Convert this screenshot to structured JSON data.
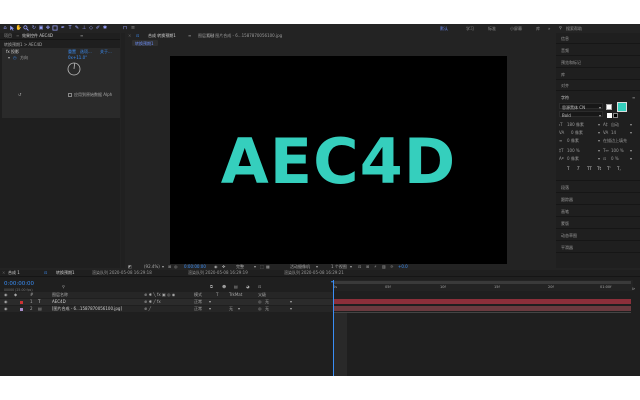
{
  "colors": {
    "accent": "#3a8ef6",
    "text_color": "#35cfbd",
    "layer_bar_1": "#8c2f3a",
    "layer_bar_2": "#6b3a3f",
    "swatch": "#35cfbd"
  },
  "toolbar": {
    "workspaces": [
      "默认",
      "学习",
      "标准",
      "小屏幕",
      "库"
    ],
    "search_placeholder": "搜索帮助"
  },
  "project": {
    "tabs": [
      "项目",
      "效果控件 AEC4D"
    ],
    "breadcrumb": "转换预期1 > AEC4D",
    "effect_name": "fx  投影",
    "reset_label": "重置",
    "options_label": "选项...",
    "about_label": "关于...",
    "prop_name": "方向",
    "prop_value": "0x+11.0°",
    "checkbox_label": "应用到原始数据 Alph"
  },
  "composition": {
    "tabs": [
      "合成 转换预期1",
      "图层 (无)",
      "素材 图片合成 - 6...1587870056100.jpg"
    ],
    "subtab": "转换预期1",
    "comp_text": "AEC4D",
    "zoom": "(92.4%)",
    "timecode": "0:00:00:00",
    "quality": "完整",
    "camera": "活动摄像机",
    "views": "1 个视图",
    "exposure": "+0.0"
  },
  "right_panel": {
    "items_top": [
      "信息",
      "音频",
      "预览和标记",
      "库",
      "对齐"
    ],
    "char_title": "字符",
    "font_family": "思源黑体 CN",
    "font_style": "Bold",
    "font_size": "180 像素",
    "leading": "自动",
    "kerning": "0 像素",
    "tracking": "14",
    "stroke": "在描边上填充",
    "vscale": "100 %",
    "hscale": "100 %",
    "baseline": "0 像素",
    "tsume": "0 %",
    "format_buttons": [
      "T",
      "T",
      "TT",
      "Tt",
      "T'",
      "T,"
    ],
    "items_bottom": [
      "段落",
      "跟踪器",
      "画笔",
      "蒙版",
      "动态草图",
      "平滑器"
    ]
  },
  "timeline": {
    "tabs": [
      "合成 1",
      "转换预期1",
      "渲染队列 2020-05-08 16:29:18",
      "渲染队列 2020-05-08 16:29:19",
      "渲染队列 2020-05-08 16:29:21"
    ],
    "timecode": "0:00:00:00",
    "frame_info": "00000 (25.00 fps)",
    "headers": [
      "图层名称",
      "模式",
      "T",
      "TrkMat",
      "父级"
    ],
    "layers": [
      {
        "num": "1",
        "name": "AEC4D",
        "mode": "正常",
        "trkmat": "",
        "parent": "无",
        "type": "text"
      },
      {
        "num": "2",
        "name": "[图片合成 - 6...1587870056100.jpg]",
        "mode": "正常",
        "trkmat": "无",
        "parent": "无",
        "type": "image"
      }
    ],
    "ruler_labels": [
      "0s",
      "05f",
      "10f",
      "15f",
      "20f",
      "01:00f"
    ]
  }
}
